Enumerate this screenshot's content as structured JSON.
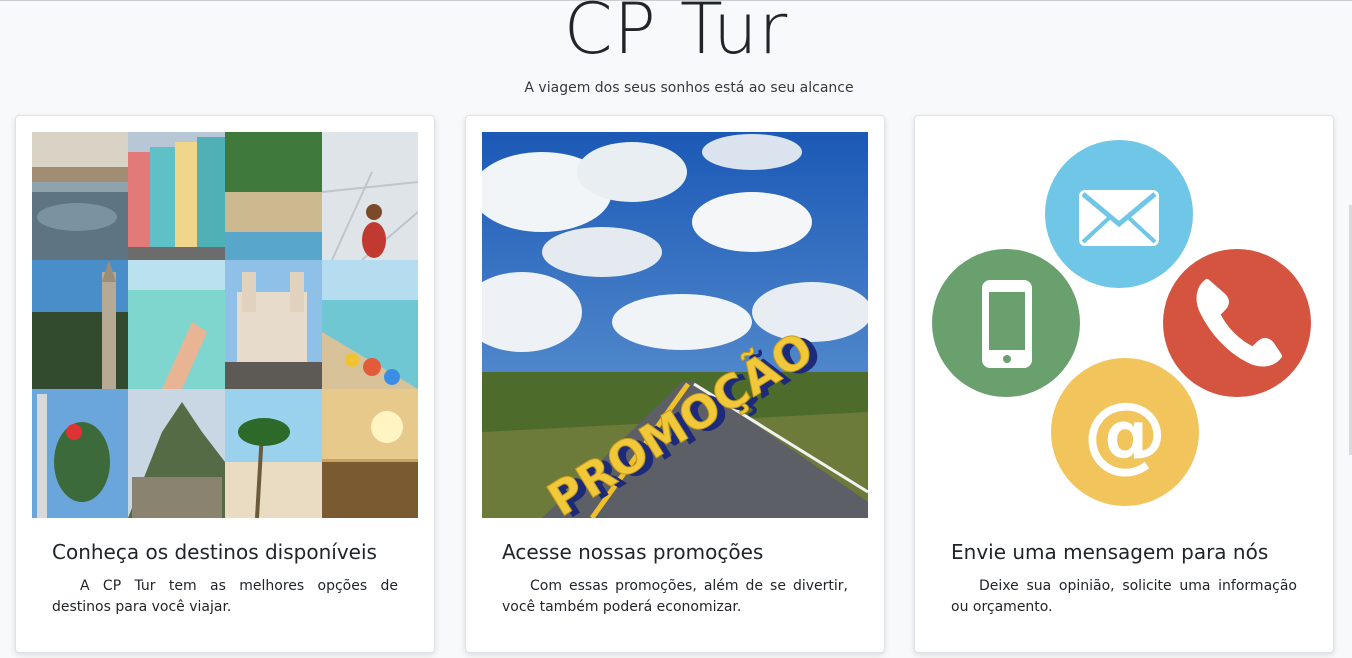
{
  "header": {
    "title": "CP Tur",
    "subtitle": "A viagem dos seus sonhos está ao seu alcance"
  },
  "cards": [
    {
      "title": "Conheça os destinos disponíveis",
      "text": "A CP Tur tem as melhores opções de destinos para você viajar.",
      "image": "destinations-collage"
    },
    {
      "title": "Acesse nossas promoções",
      "text": "Com essas promoções, além de se divertir, você também poderá economizar.",
      "image": "promotion-road",
      "image_word": "PROMOÇÃO"
    },
    {
      "title": "Envie uma mensagem para nós",
      "text": "Deixe sua opinião, solicite uma informação ou orçamento.",
      "image": "contact-icons",
      "icons": [
        "envelope-icon",
        "phone-icon",
        "phone-handset-icon",
        "at-sign-icon"
      ],
      "icon_colors": [
        "#6fc6e6",
        "#6a9f6e",
        "#d45440",
        "#f2c55c"
      ],
      "at_symbol": "@"
    }
  ]
}
